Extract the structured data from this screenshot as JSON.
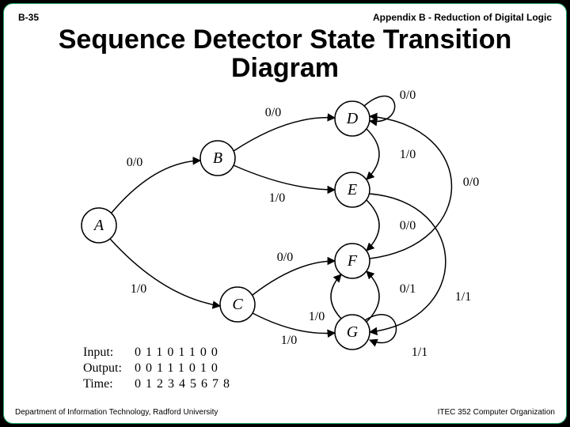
{
  "header": {
    "left": "B-35",
    "right": "Appendix B - Reduction of Digital Logic"
  },
  "title_line1": "Sequence Detector State Transition",
  "title_line2": "Diagram",
  "footer": {
    "left": "Department of Information Technology, Radford University",
    "right": "ITEC 352 Computer Organization"
  },
  "states": {
    "A": "A",
    "B": "B",
    "C": "C",
    "D": "D",
    "E": "E",
    "F": "F",
    "G": "G"
  },
  "edges": {
    "A_B": "0/0",
    "A_C": "1/0",
    "B_D": "0/0",
    "B_E": "1/0",
    "C_F": "0/0",
    "C_G": "1/0",
    "D_D": "0/0",
    "D_E": "1/0",
    "E_F": "0/0",
    "E_G": "1/1",
    "F_D": "0/0",
    "F_E": "0/1",
    "G_F": "1/0",
    "G_G": "1/1"
  },
  "io": {
    "label_input": "Input:",
    "label_output": "Output:",
    "label_time": "Time:",
    "vals_input": "01101100",
    "vals_output": "00111010",
    "vals_time": "012345678"
  }
}
